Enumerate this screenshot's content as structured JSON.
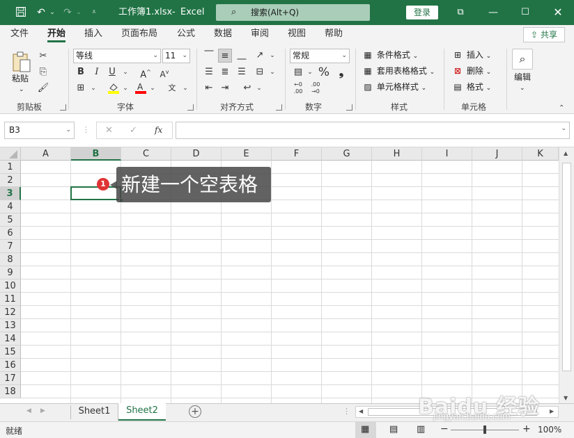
{
  "titlebar": {
    "file_name": "工作簿1.xlsx",
    "separator": "-",
    "app_name": "Excel",
    "search_placeholder": "搜索(Alt+Q)",
    "login_label": "登录"
  },
  "ribbon_tabs": [
    "文件",
    "开始",
    "插入",
    "页面布局",
    "公式",
    "数据",
    "审阅",
    "视图",
    "帮助"
  ],
  "share_label": "共享",
  "clipboard": {
    "paste_label": "粘贴",
    "group_label": "剪贴板"
  },
  "font": {
    "font_name": "等线",
    "font_size": "11",
    "group_label": "字体",
    "bold": "B",
    "italic": "I",
    "underline": "U",
    "grow": "A",
    "shrink": "A",
    "phonetic": "文"
  },
  "alignment": {
    "group_label": "对齐方式"
  },
  "number": {
    "format": "常规",
    "group_label": "数字",
    "percent": "%",
    "comma": "❟"
  },
  "styles": {
    "conditional": "条件格式",
    "table": "套用表格格式",
    "cell": "单元格样式",
    "group_label": "样式"
  },
  "cells": {
    "insert": "插入",
    "delete": "删除",
    "format": "格式",
    "group_label": "单元格"
  },
  "editing": {
    "label": "编辑"
  },
  "formula_bar": {
    "name_box": "B3",
    "fx": "fx",
    "value": ""
  },
  "columns": [
    "A",
    "B",
    "C",
    "D",
    "E",
    "F",
    "G",
    "H",
    "I",
    "J",
    "K"
  ],
  "rows": [
    "1",
    "2",
    "3",
    "4",
    "5",
    "6",
    "7",
    "8",
    "9",
    "10",
    "11",
    "12",
    "13",
    "14",
    "15",
    "16",
    "17",
    "18"
  ],
  "selected_cell": {
    "column": "B",
    "row": "3"
  },
  "sheets": [
    {
      "name": "Sheet1",
      "active": false
    },
    {
      "name": "Sheet2",
      "active": true
    }
  ],
  "status": {
    "ready": "就绪",
    "zoom": "100%"
  },
  "callout": {
    "badge": "1",
    "text": "新建一个空表格"
  },
  "watermark": {
    "brand": "Baidu 经验",
    "url": "jingyan.baidu.com"
  },
  "colors": {
    "accent": "#217346",
    "badge": "#e03434"
  }
}
